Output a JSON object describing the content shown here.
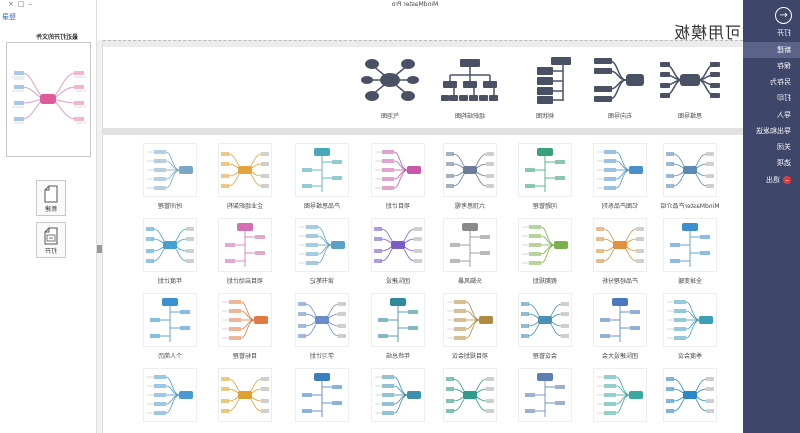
{
  "window": {
    "title": "MindMaster Pro",
    "controls": "–□×"
  },
  "login": "登录",
  "heading": "可用模板",
  "sidebar": {
    "back_icon": "←",
    "items": [
      {
        "label": "打开",
        "active": false
      },
      {
        "label": "新建",
        "active": true
      },
      {
        "label": "保存",
        "active": false
      },
      {
        "label": "另存为",
        "active": false
      },
      {
        "label": "打印",
        "active": false
      },
      {
        "label": "导入",
        "active": false
      },
      {
        "label": "导出和发送",
        "active": false
      },
      {
        "label": "关闭",
        "active": false
      },
      {
        "label": "选项",
        "active": false
      },
      {
        "label": "退出",
        "active": false,
        "icon": "exit-icon",
        "icon_color": "#e03b3b"
      }
    ]
  },
  "basic_templates": [
    {
      "label": "思维导图",
      "icon": "radial-map-icon"
    },
    {
      "label": "右向导图",
      "icon": "right-map-icon"
    },
    {
      "label": "树状图",
      "icon": "tree-map-icon"
    },
    {
      "label": "组织结构图",
      "icon": "org-chart-icon"
    },
    {
      "label": "气泡图",
      "icon": "bubble-map-icon"
    }
  ],
  "templates": [
    {
      "label": "MindMaster产品介绍",
      "accent": "#5b8bb5"
    },
    {
      "label": "亿图产品系列",
      "accent": "#4a90c8"
    },
    {
      "label": "问题管理",
      "accent": "#3aa17e"
    },
    {
      "label": "六顶思考帽",
      "accent": "#6b7b9b"
    },
    {
      "label": "项目计划",
      "accent": "#c857a8"
    },
    {
      "label": "产品思维导图",
      "accent": "#48a8b8"
    },
    {
      "label": "企业组织架构",
      "accent": "#e6a23c"
    },
    {
      "label": "时间管理",
      "accent": "#7aa7c7"
    },
    {
      "label": "全球变暖",
      "accent": "#3f8fd0"
    },
    {
      "label": "产品经理分析",
      "accent": "#e09040"
    },
    {
      "label": "假期规划",
      "accent": "#7bb04a"
    },
    {
      "label": "头脑风暴",
      "accent": "#8a8a8a"
    },
    {
      "label": "团队建设",
      "accent": "#7c5cc9"
    },
    {
      "label": "读书笔记",
      "accent": "#5ca0c8"
    },
    {
      "label": "项目启动计划",
      "accent": "#d46fb0"
    },
    {
      "label": "年度计划",
      "accent": "#46a0d0"
    },
    {
      "label": "季度会议",
      "accent": "#3d9fb8"
    },
    {
      "label": "团队建设大会",
      "accent": "#4a78c0"
    },
    {
      "label": "会议管理",
      "accent": "#4a90b8"
    },
    {
      "label": "项目规划会议",
      "accent": "#b08a40"
    },
    {
      "label": "年终总结",
      "accent": "#2f8a9a"
    },
    {
      "label": "学习计划",
      "accent": "#6a8cc8"
    },
    {
      "label": "目标管理",
      "accent": "#e07a40"
    },
    {
      "label": "个人简历",
      "accent": "#3a90d0"
    },
    {
      "accent": "#2a86c8"
    },
    {
      "accent": "#3aa7a0"
    },
    {
      "accent": "#5a7fb0"
    },
    {
      "accent": "#2f9a8a"
    },
    {
      "accent": "#3d8fb0"
    },
    {
      "accent": "#3a80c0"
    },
    {
      "accent": "#e0a030"
    },
    {
      "accent": "#4a9ad0"
    }
  ],
  "side_panel": {
    "title": "最近打开的文件",
    "new_label": "新建",
    "open_label": "打开",
    "preview_accent": "#e05a9a"
  }
}
